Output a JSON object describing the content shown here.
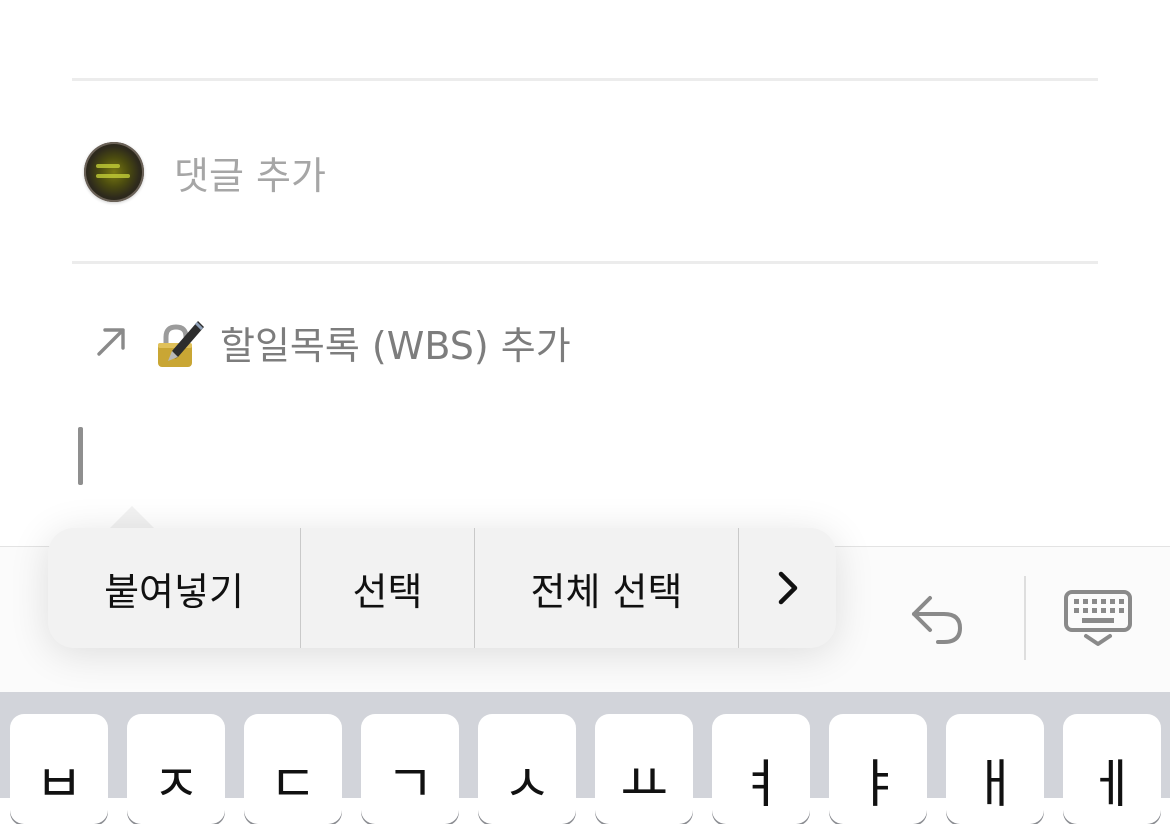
{
  "comment": {
    "placeholder": "댓글 추가"
  },
  "link": {
    "arrow_icon": "arrow-up-right-icon",
    "emoji_icon": "locked-with-pen-icon",
    "text": "할일목록 (WBS) 추가"
  },
  "edit_menu": {
    "paste": "붙여넣기",
    "select": "선택",
    "select_all": "전체 선택",
    "more": "›"
  },
  "toolbar": {
    "undo_icon": "undo-arrow-icon",
    "keyboard_icon": "keyboard-dismiss-icon"
  },
  "keyboard": {
    "keys": [
      "ㅂ",
      "ㅈ",
      "ㄷ",
      "ㄱ",
      "ㅅ",
      "ㅛ",
      "ㅕ",
      "ㅑ",
      "ㅐ",
      "ㅔ"
    ]
  },
  "colors": {
    "placeholder": "#a6a6a6",
    "link_text": "#7d7d7d",
    "keyboard_bg": "#d2d4da",
    "menu_bg": "#f2f2f2"
  }
}
